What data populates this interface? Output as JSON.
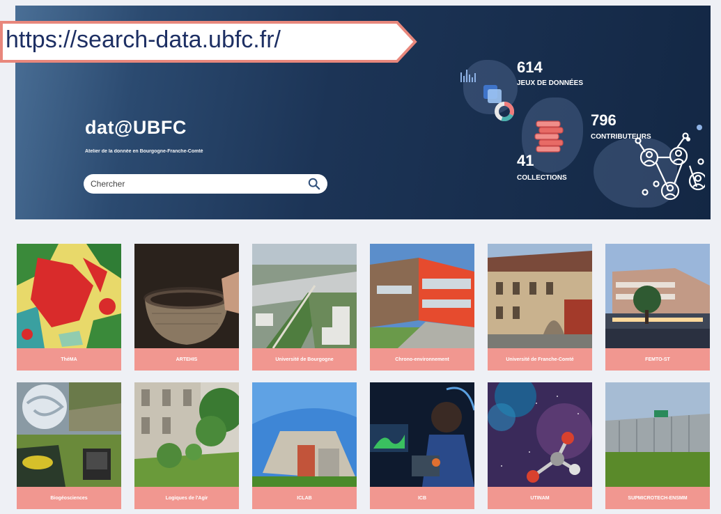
{
  "url_callout": "https://search-data.ubfc.fr/",
  "hero": {
    "title": "dat@UBFC",
    "subtitle": "Atelier de la donnée en Bourgogne-Franche-Comté",
    "search_placeholder": "Chercher"
  },
  "stats": {
    "datasets": {
      "value": "614",
      "label": "JEUX DE DONNÉES"
    },
    "contributors": {
      "value": "796",
      "label": "CONTRIBUTEURS"
    },
    "collections": {
      "value": "41",
      "label": "COLLECTIONS"
    }
  },
  "collections": [
    {
      "label": "ThéMA"
    },
    {
      "label": "ARTEHIS"
    },
    {
      "label": "Université de Bourgogne"
    },
    {
      "label": "Chrono-environnement"
    },
    {
      "label": "Université de Franche-Comté"
    },
    {
      "label": "FEMTO-ST"
    },
    {
      "label": "Biogéosciences"
    },
    {
      "label": "Logiques de l'Agir"
    },
    {
      "label": "ICLAB"
    },
    {
      "label": "ICB"
    },
    {
      "label": "UTINAM"
    },
    {
      "label": "SUPMICROTECH-ENSMM"
    }
  ],
  "colors": {
    "card_label_bg": "#f19790",
    "hero_bg": "#1c3456",
    "callout_border": "#e8877c",
    "callout_text": "#1d2f63"
  }
}
